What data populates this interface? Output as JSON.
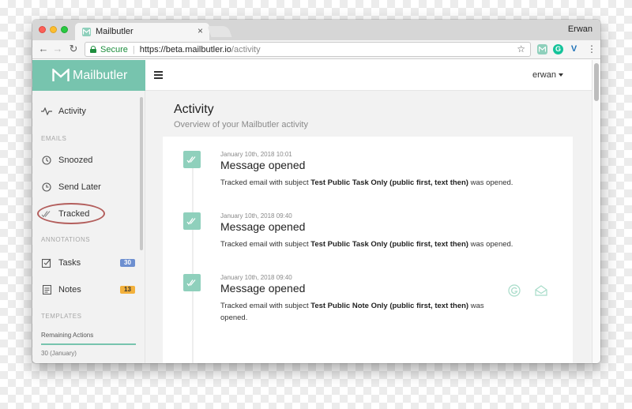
{
  "browser": {
    "tab_title": "Mailbutler",
    "tab_close": "×",
    "profile_name": "Erwan",
    "secure_label": "Secure",
    "url_main": "https://beta.mailbutler.io",
    "url_path": "/activity",
    "ext_grammarly": "G",
    "ext_v": "V"
  },
  "app": {
    "brand": "Mailbutler",
    "user_name": "erwan",
    "accent_color": "#77c4ae"
  },
  "sidebar": {
    "activity": "Activity",
    "section_emails": "EMAILS",
    "snoozed": "Snoozed",
    "send_later": "Send Later",
    "tracked": "Tracked",
    "section_annotations": "ANNOTATIONS",
    "tasks": "Tasks",
    "tasks_count": "30",
    "notes": "Notes",
    "notes_count": "13",
    "section_templates": "TEMPLATES",
    "remaining_label": "Remaining Actions",
    "remaining_value": "30 (January)",
    "remaining_fraction": 1.0
  },
  "main": {
    "title": "Activity",
    "subtitle": "Overview of your Mailbutler activity",
    "entries": [
      {
        "date": "January 10th, 2018 10:01",
        "title": "Message opened",
        "prefix": "Tracked email with subject ",
        "subject": "Test Public Task Only (public first, text then)",
        "suffix": " was opened."
      },
      {
        "date": "January 10th, 2018 09:40",
        "title": "Message opened",
        "prefix": "Tracked email with subject ",
        "subject": "Test Public Task Only (public first, text then)",
        "suffix": " was opened."
      },
      {
        "date": "January 10th, 2018 09:40",
        "title": "Message opened",
        "prefix": "Tracked email with subject ",
        "subject": "Test Public Note Only (public first, text then)",
        "suffix": " was opened."
      }
    ]
  }
}
